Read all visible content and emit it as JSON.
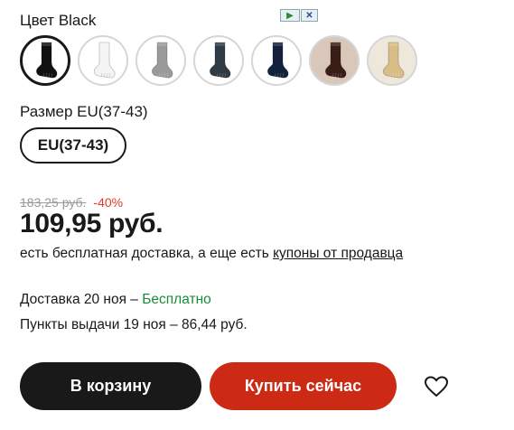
{
  "ad_badge": {
    "play_icon": "play-icon",
    "close_icon": "close-icon"
  },
  "color": {
    "label": "Цвет Black",
    "options": [
      {
        "name": "black",
        "selected": true,
        "sock": "#111111",
        "bg": "#ffffff"
      },
      {
        "name": "white",
        "selected": false,
        "sock": "#f4f4f4",
        "bg": "#ffffff"
      },
      {
        "name": "gray",
        "selected": false,
        "sock": "#9a9a9a",
        "bg": "#ffffff"
      },
      {
        "name": "dark-gray",
        "selected": false,
        "sock": "#2e3a44",
        "bg": "#ffffff"
      },
      {
        "name": "navy",
        "selected": false,
        "sock": "#13213d",
        "bg": "#ffffff"
      },
      {
        "name": "brown",
        "selected": false,
        "sock": "#3b1d18",
        "bg": "#d9c7b9"
      },
      {
        "name": "beige",
        "selected": false,
        "sock": "#d8bd86",
        "bg": "#eee7db"
      }
    ]
  },
  "size": {
    "label": "Размер EU(37-43)",
    "selected": "EU(37-43)"
  },
  "pricing": {
    "old_price": "183,25 руб.",
    "discount": "-40%",
    "price": "109,95 руб.",
    "delivery_note_prefix": "есть бесплатная доставка, а еще есть ",
    "delivery_note_link": "купоны от продавца"
  },
  "shipping": {
    "delivery_prefix": "Доставка 20 ноя – ",
    "delivery_free": "Бесплатно",
    "pickup": "Пункты выдачи 19 ноя – 86,44 руб."
  },
  "actions": {
    "add_to_cart": "В корзину",
    "buy_now": "Купить сейчас",
    "wishlist_icon": "heart-icon"
  },
  "colors": {
    "text": "#191919",
    "accent_red": "#cc2a14",
    "discount_red": "#e23a2b",
    "free_green": "#1a8a3a",
    "button_dark": "#191919"
  }
}
